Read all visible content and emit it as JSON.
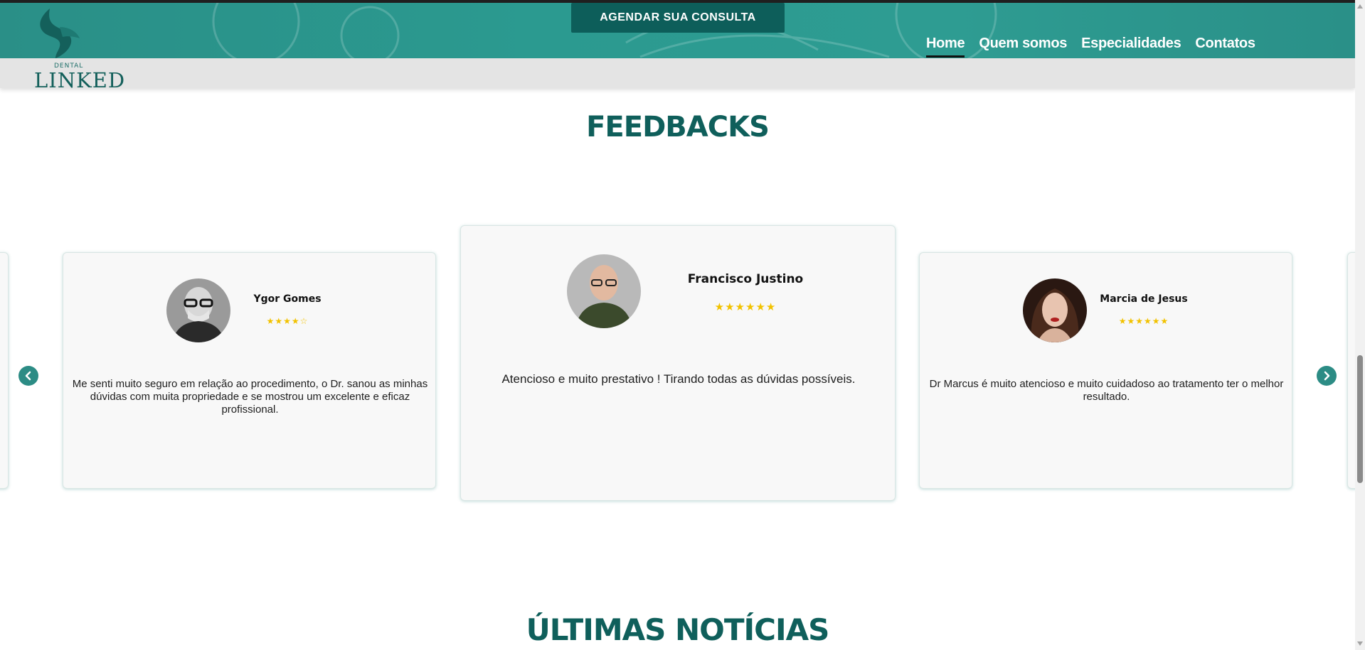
{
  "header": {
    "cta_label": "AGENDAR SUA CONSULTA",
    "logo": {
      "small_text": "DENTAL",
      "main_text": "LINKED"
    },
    "nav": [
      {
        "label": "Home",
        "active": true
      },
      {
        "label": "Quem somos",
        "active": false
      },
      {
        "label": "Especialidades",
        "active": false
      },
      {
        "label": "Contatos",
        "active": false
      }
    ]
  },
  "feedbacks": {
    "title": "FEEDBACKS",
    "cards": [
      {
        "name": "Ygor Gomes",
        "stars": "★★★★☆",
        "rating": 4,
        "quote": "Me senti muito seguro em relação ao procedimento, o Dr. sanou as minhas dúvidas com muita propriedade e se mostrou um excelente e eficaz profissional."
      },
      {
        "name": "Francisco Justino",
        "stars": "★★★★★★",
        "rating": 6,
        "quote": "Atencioso e muito prestativo ! Tirando todas as dúvidas possíveis."
      },
      {
        "name": "Marcia de Jesus",
        "stars": "★★★★★★",
        "rating": 6,
        "quote": "Dr Marcus é muito atencioso e muito cuidadoso ao tratamento ter o melhor resultado."
      }
    ],
    "prev_icon": "chevron-left-icon",
    "next_icon": "chevron-right-icon"
  },
  "news": {
    "title": "ÚLTIMAS NOTÍCIAS"
  },
  "colors": {
    "brand": "#0f5f5b",
    "header": "#2b9a90",
    "star": "#f2c200"
  }
}
